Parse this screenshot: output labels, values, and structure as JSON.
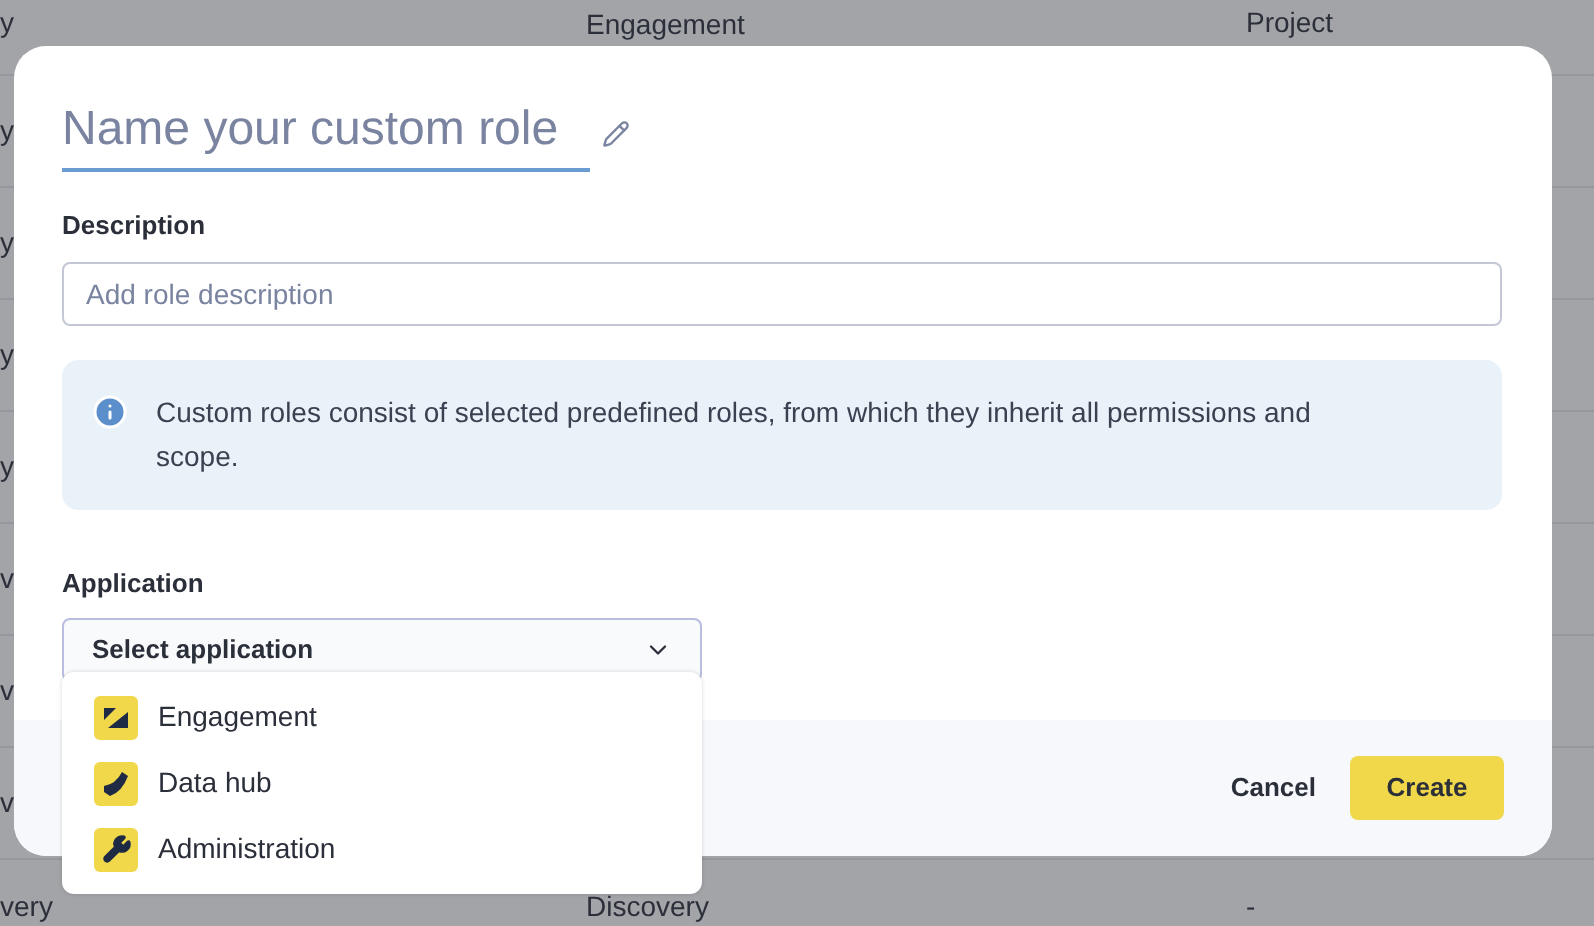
{
  "background_table": {
    "rows": [
      {
        "column_1": "y",
        "column_2": "Engagement",
        "column_3": "Project"
      },
      {
        "column_1": "y"
      },
      {
        "column_1": "y"
      },
      {
        "column_1": "y"
      },
      {
        "column_1": "y"
      },
      {
        "column_1": "v"
      },
      {
        "column_1": "v"
      },
      {
        "column_1": "v"
      },
      {
        "column_1": "very",
        "column_2": "Discovery",
        "column_3": "-"
      }
    ]
  },
  "dialog": {
    "name_field": {
      "placeholder": "Name your custom role"
    },
    "description": {
      "label": "Description",
      "placeholder": "Add role description"
    },
    "info": "Custom roles consist of selected predefined roles, from which they inherit all permissions and scope.",
    "application": {
      "label": "Application",
      "placeholder": "Select application",
      "expanded": true,
      "options": [
        {
          "label": "Engagement",
          "kind": "engagement"
        },
        {
          "label": "Data hub",
          "kind": "datahub"
        },
        {
          "label": "Administration",
          "kind": "admin"
        }
      ]
    },
    "buttons": {
      "cancel": "Cancel",
      "create": "Create"
    }
  }
}
